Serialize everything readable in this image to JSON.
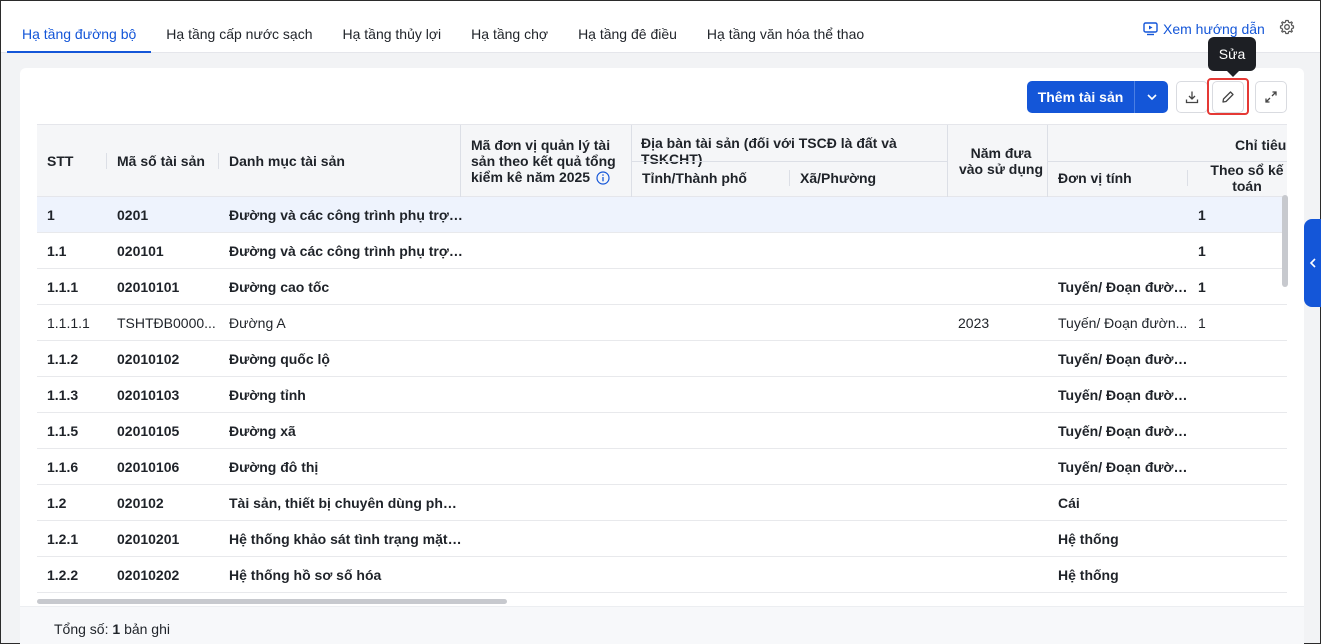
{
  "tabs": [
    {
      "label": "Hạ tầng đường bộ",
      "active": true
    },
    {
      "label": "Hạ tầng cấp nước sạch",
      "active": false
    },
    {
      "label": "Hạ tầng thủy lợi",
      "active": false
    },
    {
      "label": "Hạ tầng chợ",
      "active": false
    },
    {
      "label": "Hạ tầng đê điều",
      "active": false
    },
    {
      "label": "Hạ tầng văn hóa thể thao",
      "active": false
    }
  ],
  "header": {
    "guide_label": "Xem hướng dẫn"
  },
  "toolbar": {
    "add_label": "Thêm tài sản",
    "edit_tooltip": "Sửa"
  },
  "table": {
    "headers": {
      "stt": "STT",
      "ma_so": "Mã số tài sản",
      "danh_muc": "Danh mục tài sản",
      "ma_don_vi": "Mã đơn vị quản lý tài sản theo kết quả tổng kiểm kê năm 2025",
      "dia_ban": "Địa bàn tài sản (đối với TSCĐ là đất và TSKCHT)",
      "tinh": "Tỉnh/Thành phố",
      "xa": "Xã/Phường",
      "nam_dua": "Năm đưa vào sử dụng",
      "chi_tieu": "Chỉ tiêu",
      "don_vi_tinh": "Đơn vị tính",
      "theo_so": "Theo sổ kế toán"
    },
    "rows": [
      {
        "stt": "1",
        "ma": "0201",
        "dm": "Đường và các công trình phụ trợ g...",
        "nam": "",
        "dvt": "",
        "so": "1",
        "bold": true,
        "selected": true
      },
      {
        "stt": "1.1",
        "ma": "020101",
        "dm": "Đường và các công trình phụ trợ g...",
        "nam": "",
        "dvt": "",
        "so": "1",
        "bold": true,
        "selected": false
      },
      {
        "stt": "1.1.1",
        "ma": "02010101",
        "dm": "Đường cao tốc",
        "nam": "",
        "dvt": "Tuyến/ Đoạn đườn...",
        "so": "1",
        "bold": true,
        "selected": false
      },
      {
        "stt": "1.1.1.1",
        "ma": "TSHTĐB0000...",
        "dm": "Đường A",
        "nam": "2023",
        "dvt": "Tuyến/ Đoạn đườn...",
        "so": "1",
        "bold": false,
        "selected": false
      },
      {
        "stt": "1.1.2",
        "ma": "02010102",
        "dm": "Đường quốc lộ",
        "nam": "",
        "dvt": "Tuyến/ Đoạn đườn...",
        "so": "",
        "bold": true,
        "selected": false
      },
      {
        "stt": "1.1.3",
        "ma": "02010103",
        "dm": "Đường tỉnh",
        "nam": "",
        "dvt": "Tuyến/ Đoạn đườn...",
        "so": "",
        "bold": true,
        "selected": false
      },
      {
        "stt": "1.1.5",
        "ma": "02010105",
        "dm": "Đường xã",
        "nam": "",
        "dvt": "Tuyến/ Đoạn đườn...",
        "so": "",
        "bold": true,
        "selected": false
      },
      {
        "stt": "1.1.6",
        "ma": "02010106",
        "dm": "Đường đô thị",
        "nam": "",
        "dvt": "Tuyến/ Đoạn đườn...",
        "so": "",
        "bold": true,
        "selected": false
      },
      {
        "stt": "1.2",
        "ma": "020102",
        "dm": "Tài sản, thiết bị chuyên dùng phục ...",
        "nam": "",
        "dvt": "Cái",
        "so": "",
        "bold": true,
        "selected": false
      },
      {
        "stt": "1.2.1",
        "ma": "02010201",
        "dm": "Hệ thống khảo sát tình trạng mặt đ...",
        "nam": "",
        "dvt": "Hệ thống",
        "so": "",
        "bold": true,
        "selected": false
      },
      {
        "stt": "1.2.2",
        "ma": "02010202",
        "dm": "Hệ thống hồ sơ số hóa",
        "nam": "",
        "dvt": "Hệ thống",
        "so": "",
        "bold": true,
        "selected": false
      }
    ]
  },
  "footer": {
    "total_prefix": "Tổng số:",
    "total_count": "1",
    "total_suffix": "bản ghi"
  },
  "colors": {
    "accent": "#1456d8",
    "highlight": "#e53935"
  }
}
